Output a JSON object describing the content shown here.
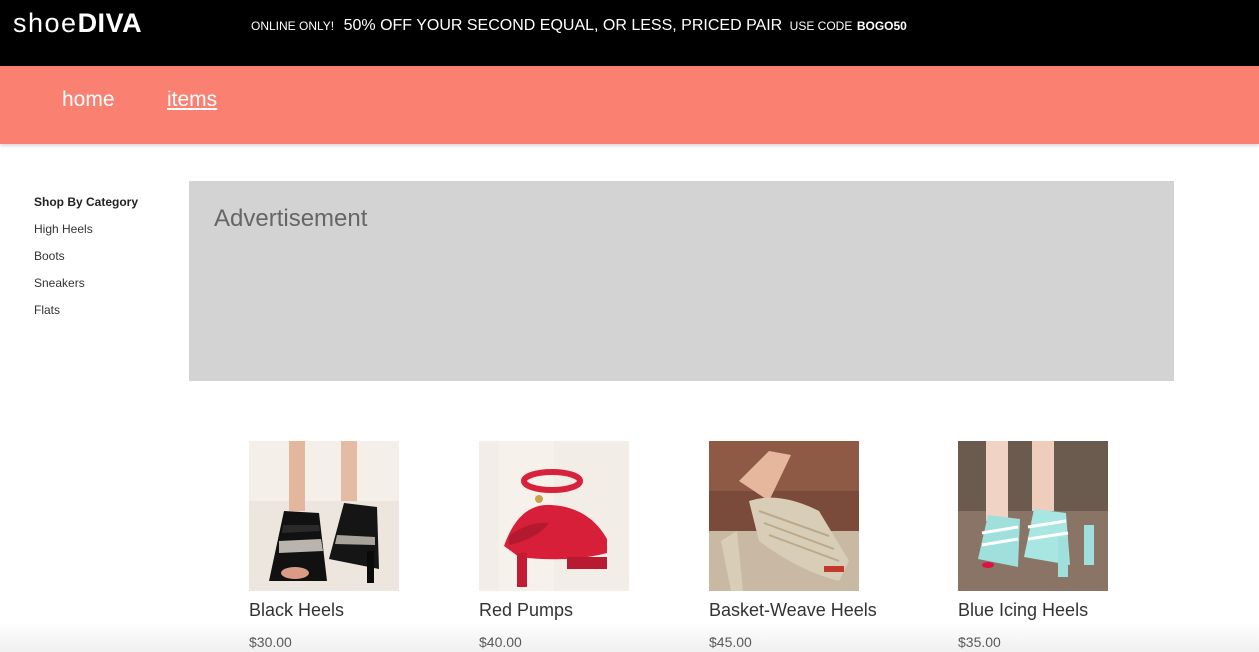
{
  "header": {
    "logo_light": "shoe",
    "logo_bold": "DIVA",
    "promo_prefix": "ONLINE ONLY!",
    "promo_main": "50% OFF YOUR SECOND EQUAL, OR LESS, PRICED PAIR",
    "promo_code_label": "USE CODE",
    "promo_code": "BOGO50"
  },
  "nav": {
    "home": "home",
    "items": "items"
  },
  "sidebar": {
    "heading": "Shop By Category",
    "categories": [
      "High Heels",
      "Boots",
      "Sneakers",
      "Flats"
    ]
  },
  "ad": {
    "label": "Advertisement"
  },
  "products": [
    {
      "name": "Black Heels",
      "price": "$30.00"
    },
    {
      "name": "Red Pumps",
      "price": "$40.00"
    },
    {
      "name": "Basket-Weave Heels",
      "price": "$45.00"
    },
    {
      "name": "Blue Icing Heels",
      "price": "$35.00"
    }
  ],
  "colors": {
    "topbar": "#000000",
    "navbar": "#fa8072",
    "ad_background": "#d3d3d3"
  }
}
